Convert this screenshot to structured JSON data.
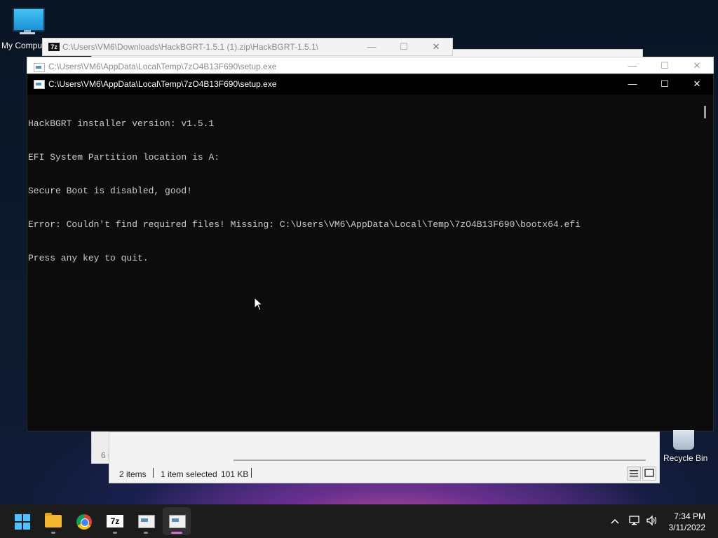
{
  "desktop": {
    "my_computer_label": "My Compu",
    "recycle_bin_label": "Recycle Bin"
  },
  "sevenzip_window": {
    "title": "C:\\Users\\VM6\\Downloads\\HackBGRT-1.5.1 (1).zip\\HackBGRT-1.5.1\\",
    "icon_text": "7z",
    "status": {
      "items": "2 items",
      "selected": "1 item selected",
      "size": "101 KB",
      "side_count": "6 i"
    }
  },
  "console_back": {
    "title": "C:\\Users\\VM6\\AppData\\Local\\Temp\\7zO4B13F690\\setup.exe"
  },
  "console": {
    "title": "C:\\Users\\VM6\\AppData\\Local\\Temp\\7zO4B13F690\\setup.exe",
    "lines": [
      "HackBGRT installer version: v1.5.1",
      "EFI System Partition location is A:",
      "Secure Boot is disabled, good!",
      "Error: Couldn't find required files! Missing: C:\\Users\\VM6\\AppData\\Local\\Temp\\7zO4B13F690\\bootx64.efi",
      "Press any key to quit."
    ]
  },
  "caption_buttons": {
    "minimize": "—",
    "maximize": "☐",
    "close": "✕"
  },
  "taskbar": {
    "items": [
      "start",
      "file-explorer",
      "chrome",
      "7-zip",
      "console",
      "console-active"
    ],
    "clock_time": "7:34 PM",
    "clock_date": "3/11/2022"
  }
}
